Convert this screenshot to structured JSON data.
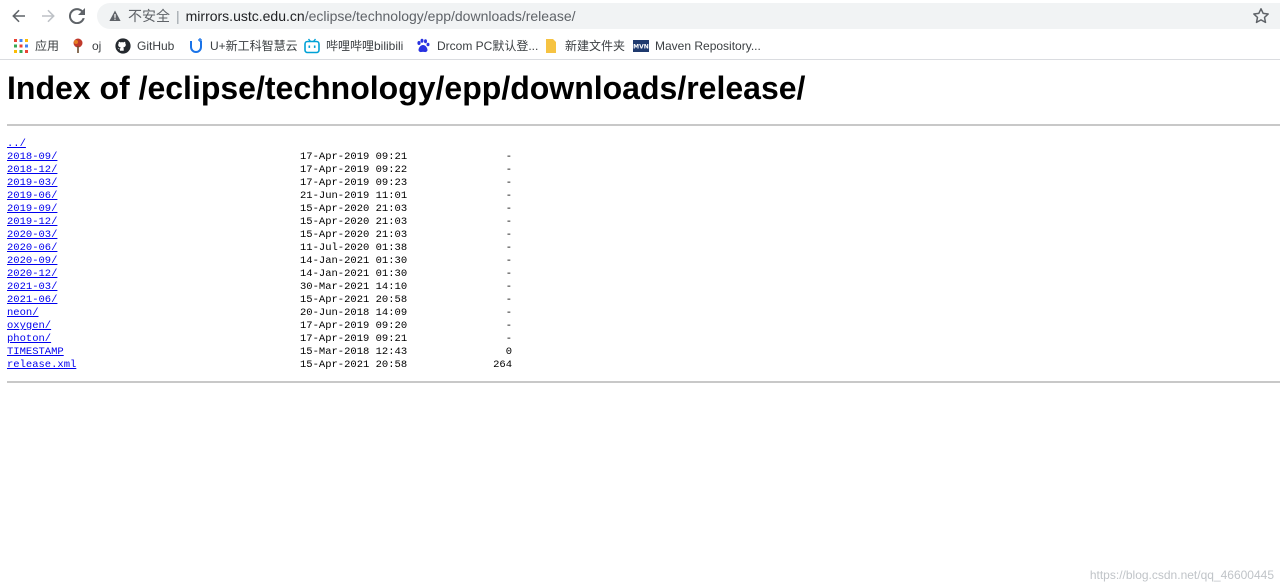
{
  "omnibox": {
    "security_label": "不安全",
    "separator": "|",
    "host": "mirrors.ustc.edu.cn",
    "path": "/eclipse/technology/epp/downloads/release/"
  },
  "bookmarks": [
    {
      "label": "应用",
      "icon": "apps-grid-icon"
    },
    {
      "label": "oj",
      "icon": "tree-icon"
    },
    {
      "label": "GitHub",
      "icon": "github-icon"
    },
    {
      "label": "U+新工科智慧云",
      "icon": "u-plus-icon"
    },
    {
      "label": "哔哩哔哩bilibili",
      "icon": "bilibili-icon"
    },
    {
      "label": "Drcom PC默认登...",
      "icon": "baidu-paw-icon"
    },
    {
      "label": "新建文件夹",
      "icon": "folder-icon"
    },
    {
      "label": "Maven Repository...",
      "icon": "maven-icon"
    }
  ],
  "page": {
    "title": "Index of /eclipse/technology/epp/downloads/release/",
    "parent_link": "../",
    "entries": [
      {
        "name": "2018-09/",
        "date": "17-Apr-2019 09:21",
        "size": "-"
      },
      {
        "name": "2018-12/",
        "date": "17-Apr-2019 09:22",
        "size": "-"
      },
      {
        "name": "2019-03/",
        "date": "17-Apr-2019 09:23",
        "size": "-"
      },
      {
        "name": "2019-06/",
        "date": "21-Jun-2019 11:01",
        "size": "-"
      },
      {
        "name": "2019-09/",
        "date": "15-Apr-2020 21:03",
        "size": "-"
      },
      {
        "name": "2019-12/",
        "date": "15-Apr-2020 21:03",
        "size": "-"
      },
      {
        "name": "2020-03/",
        "date": "15-Apr-2020 21:03",
        "size": "-"
      },
      {
        "name": "2020-06/",
        "date": "11-Jul-2020 01:38",
        "size": "-"
      },
      {
        "name": "2020-09/",
        "date": "14-Jan-2021 01:30",
        "size": "-"
      },
      {
        "name": "2020-12/",
        "date": "14-Jan-2021 01:30",
        "size": "-"
      },
      {
        "name": "2021-03/",
        "date": "30-Mar-2021 14:10",
        "size": "-"
      },
      {
        "name": "2021-06/",
        "date": "15-Apr-2021 20:58",
        "size": "-"
      },
      {
        "name": "neon/",
        "date": "20-Jun-2018 14:09",
        "size": "-"
      },
      {
        "name": "oxygen/",
        "date": "17-Apr-2019 09:20",
        "size": "-"
      },
      {
        "name": "photon/",
        "date": "17-Apr-2019 09:21",
        "size": "-"
      },
      {
        "name": "TIMESTAMP",
        "date": "15-Mar-2018 12:43",
        "size": "0"
      },
      {
        "name": "release.xml",
        "date": "15-Apr-2021 20:58",
        "size": "264"
      }
    ]
  },
  "watermark": "https://blog.csdn.net/qq_46600445",
  "colors": {
    "link": "#0000ee",
    "rule": "#c8c8c8",
    "omnibox_bg": "#f1f3f4"
  }
}
